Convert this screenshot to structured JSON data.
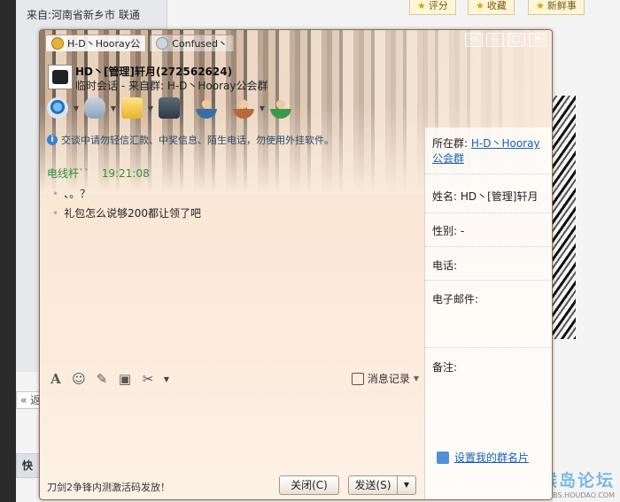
{
  "background": {
    "from_text": "来自:河南省新乡市 联通",
    "buttons": [
      {
        "icon": "star-icon",
        "label": "评分"
      },
      {
        "icon": "star-icon",
        "label": "收藏"
      },
      {
        "icon": "star-icon",
        "label": "新鲜事"
      }
    ],
    "back_button": "« 返",
    "quick_label": "快",
    "watermark_title": "猴岛论坛",
    "watermark_sub": "BBS.HOUDAO.COM"
  },
  "window": {
    "tabs": [
      {
        "label": "H-D丶Hooray公",
        "active": true
      },
      {
        "label": "Confused丶",
        "active": false
      }
    ],
    "controls": [
      "▭",
      "—",
      "□",
      "✕"
    ],
    "header": {
      "name": "HD丶[管理]轩月(272562624)",
      "subtitle": "临时会话 - 来自群: H-D丶Hooray公会群"
    },
    "notice": "交谈中请勿轻信汇款、中奖信息、陌生电话，勿使用外挂软件。",
    "message": {
      "sender": "电线杆``",
      "time": "19:21:08",
      "lines": [
        "、。？",
        "礼包怎么说够200都让领了吧"
      ]
    },
    "sidebar": {
      "group_label": "所在群:",
      "group_link": "H-D丶Hooray公会群",
      "name_row": "姓名: HD丶[管理]轩月",
      "gender_row": "性别: -",
      "phone_row": "电话:",
      "email_row": "电子邮件:",
      "note_row": "备注:",
      "set_card_link": "设置我的群名片"
    },
    "format_bar": {
      "history_label": "消息记录"
    },
    "status_text": "刀剑2争锋内测激活码发放！",
    "close_button": "关闭(C)",
    "send_button": "发送(S)"
  }
}
